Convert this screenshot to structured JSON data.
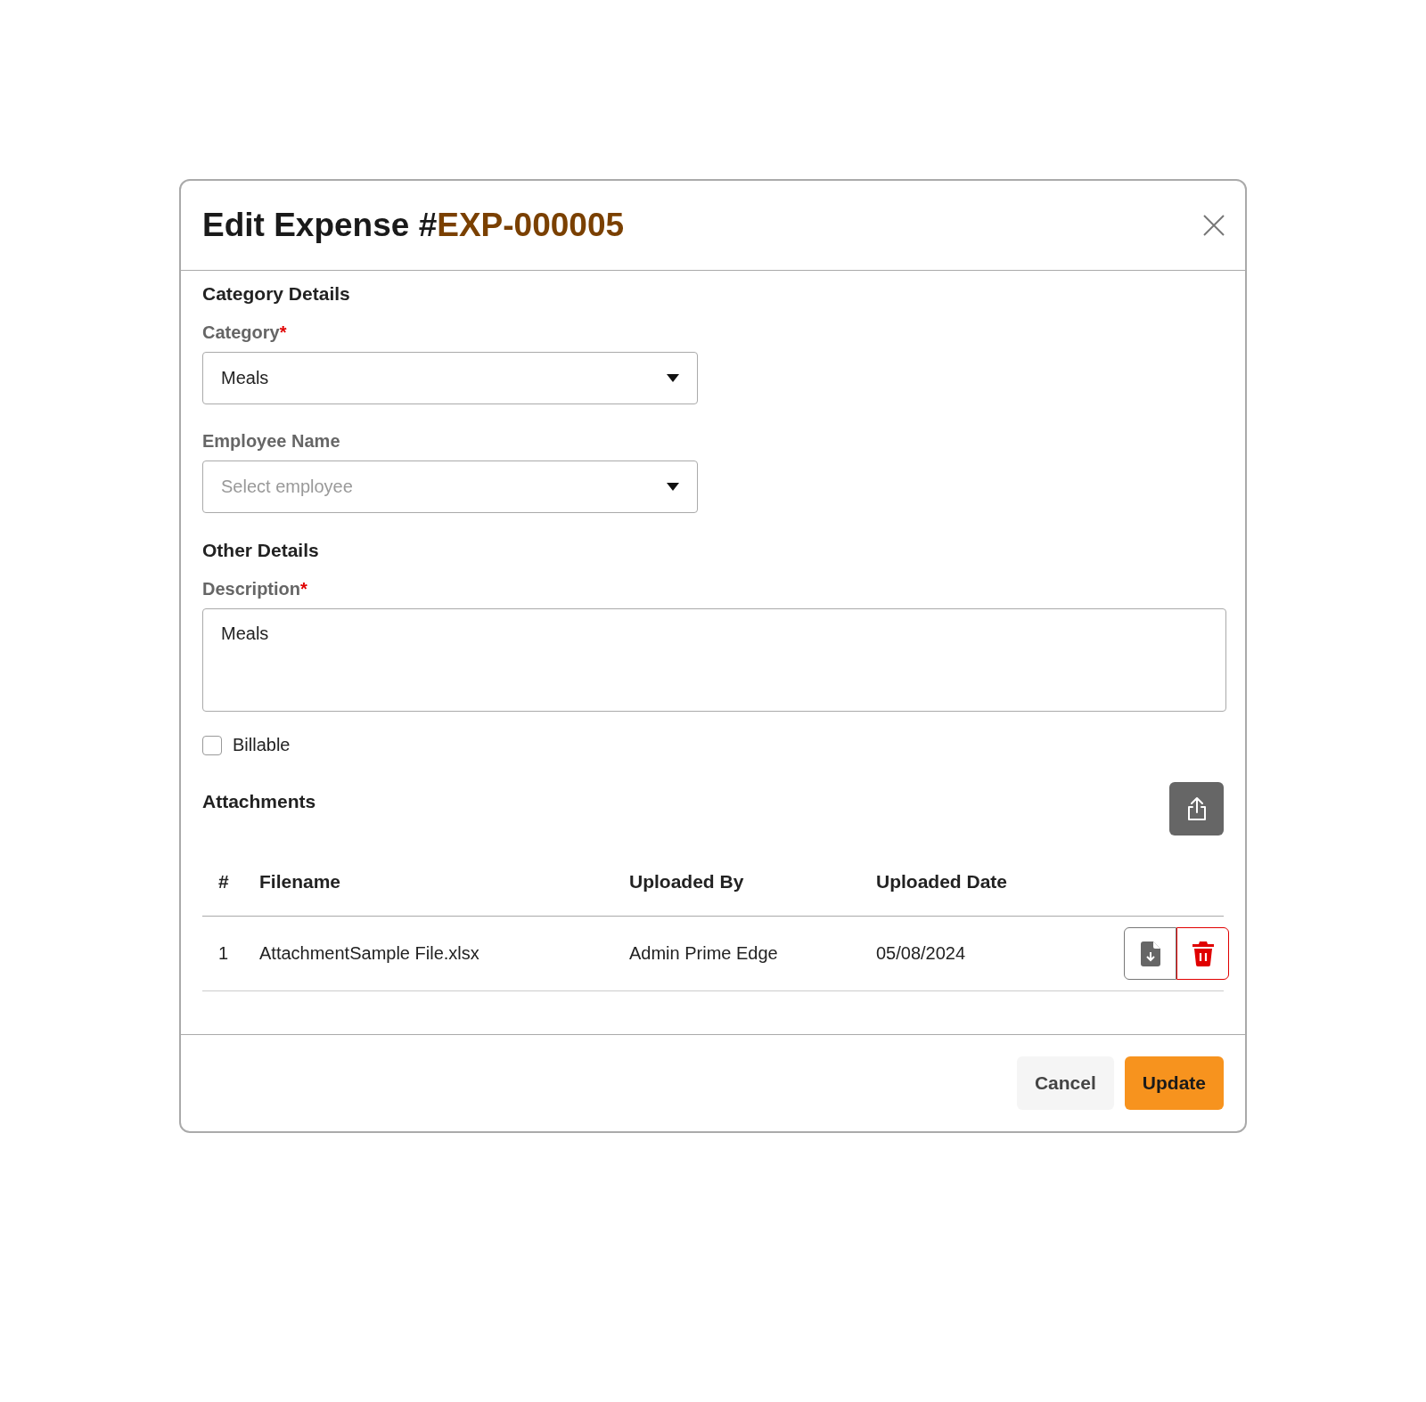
{
  "dialog": {
    "title": "Edit Expense #",
    "number": "EXP-000005"
  },
  "sections": [
    {
      "heading": "Category Details",
      "fields": [
        {
          "kind": "select",
          "label": "Category",
          "required_mark": "*",
          "value": "Meals"
        },
        {
          "kind": "select",
          "label": "Employee Name",
          "placeholder": "Select employee"
        }
      ]
    },
    {
      "heading": "Other Details",
      "fields": [
        {
          "kind": "textarea",
          "label": "Description",
          "required_mark": "*",
          "value": "Meals"
        },
        {
          "kind": "checkbox",
          "label": "Billable",
          "checked": false
        }
      ]
    }
  ],
  "attachments": {
    "heading": "Attachments",
    "columns": [
      "#",
      "Filename",
      "Uploaded By",
      "Uploaded Date"
    ],
    "rows": [
      {
        "cells": [
          "1",
          "AttachmentSample File.xlsx",
          "Admin Prime Edge",
          "05/08/2024"
        ]
      }
    ]
  },
  "buttons": [
    {
      "label": "Cancel",
      "kind": "secondary"
    },
    {
      "label": "Update",
      "kind": "primary"
    }
  ]
}
